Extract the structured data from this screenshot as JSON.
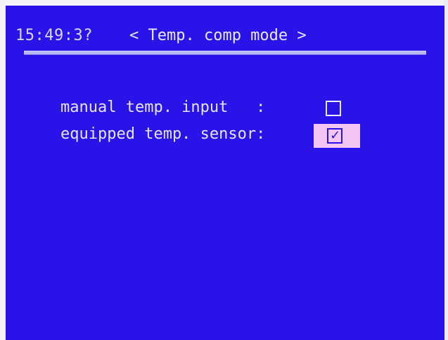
{
  "header": {
    "time": "15:49:3?",
    "title": "< Temp. comp mode >"
  },
  "options": [
    {
      "label": "manual temp. input   :",
      "checked": false,
      "selected": false
    },
    {
      "label": "equipped temp. sensor:",
      "checked": true,
      "selected": true
    }
  ],
  "colors": {
    "screen_background": "#2a13e8",
    "text": "#e6e6ff",
    "selection_highlight": "#f3c6f4"
  },
  "icons": {
    "unchecked": "checkbox-unchecked-icon",
    "checked": "checkbox-checked-icon"
  }
}
